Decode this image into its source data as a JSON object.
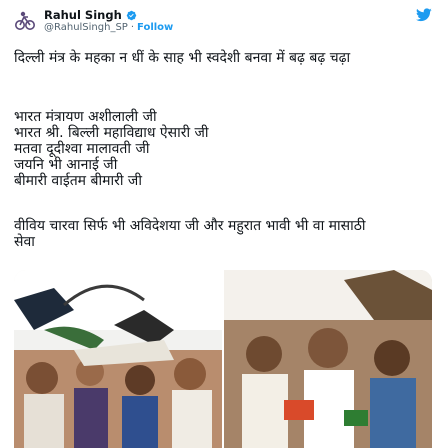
{
  "tweet": {
    "author_name": "Rahul Singh",
    "author_handle": "@RahulSingh_SP",
    "separator": "·",
    "follow_label": "Follow",
    "paragraph1": "दिल्ली मंत्र के महका न धीं के साह भी स्वदेशी बनवा में बढ़ बढ़ चढ़ा",
    "paragraph2": "भारत मंत्रायण अशीलाली जी\nभारत श्री. बिल्ली महाविद्याध ऐसारी जी\nमतवा दूदीश्वा मालावती जी\nजयनि भी आनाई जी\nबीमारी वाईतम बीमारी जी",
    "paragraph3": "वीविय चारवा सिर्फ भी अविदेशया जी और महुरात भावी भी वा मासाठी\nसेवा",
    "icons": {
      "verified": "verified-badge-icon",
      "bird": "twitter-bird-icon",
      "avatar": "cycle-logo-avatar"
    },
    "colors": {
      "accent": "#1d9bf0",
      "text": "#0f1419",
      "muted": "#536471"
    }
  }
}
